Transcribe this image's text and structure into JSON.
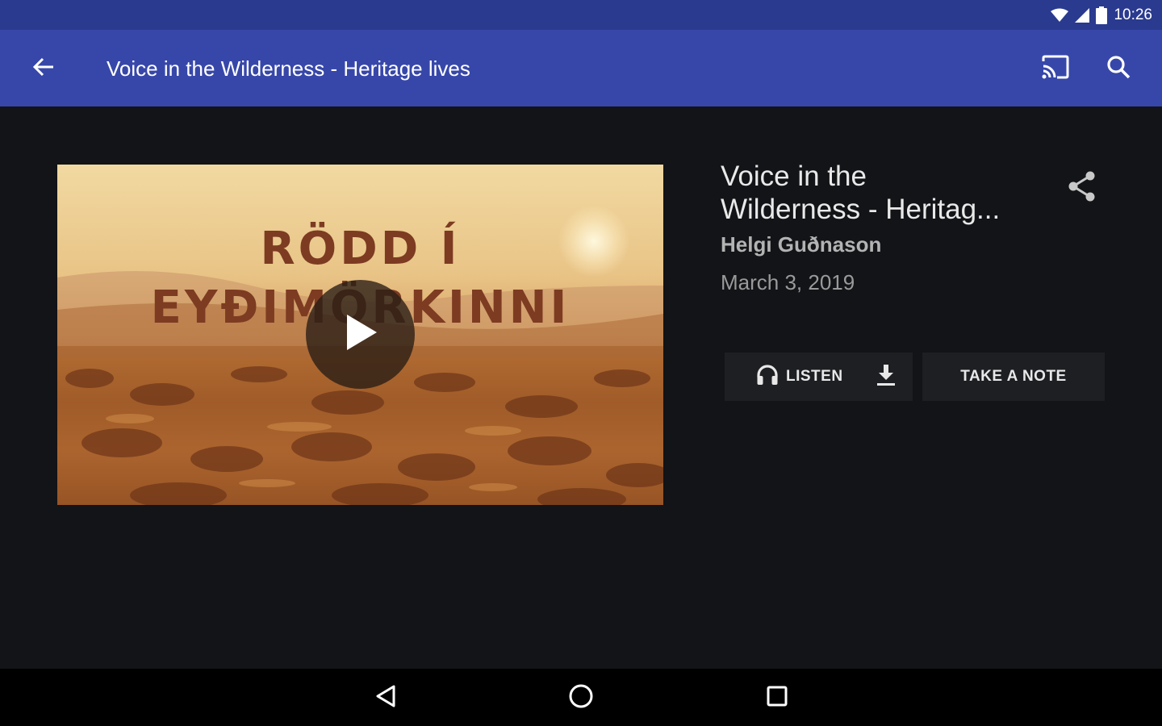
{
  "status_bar": {
    "time": "10:26",
    "icons": [
      "wifi-icon",
      "cell-signal-icon",
      "battery-icon"
    ]
  },
  "app_bar": {
    "title": "Voice in the Wilderness - Heritage lives",
    "back_icon": "arrow-left-icon",
    "cast_icon": "cast-icon",
    "search_icon": "search-icon",
    "background": "#3747a9"
  },
  "video": {
    "thumbnail_text_line1": "RÖDD Í",
    "thumbnail_text_line2": "EYÐIMÖRKINNI",
    "play_icon": "play-icon"
  },
  "detail": {
    "title": "Voice in the Wilderness - Heritag...",
    "author": "Helgi Guðnason",
    "date": "March 3, 2019",
    "share_icon": "share-icon"
  },
  "actions": {
    "listen_label": "LISTEN",
    "listen_icon": "headphones-icon",
    "download_icon": "download-icon",
    "note_label": "TAKE A NOTE"
  },
  "nav_bar": {
    "icons": [
      "back-triangle-icon",
      "home-circle-icon",
      "recents-square-icon"
    ]
  }
}
